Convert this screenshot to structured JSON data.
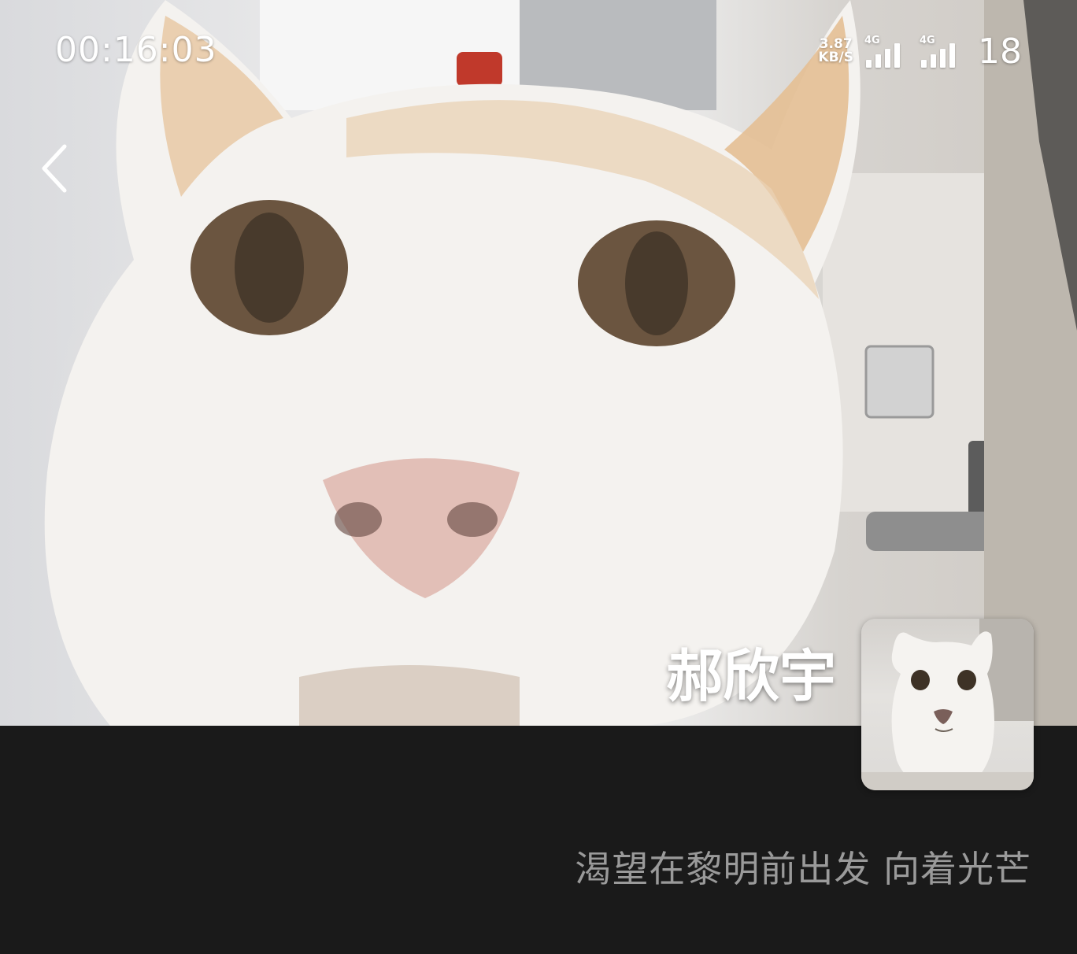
{
  "status_bar": {
    "time": "00:16:03",
    "net_speed_value": "3.87",
    "net_speed_unit": "KB/S",
    "sim1_type": "4G",
    "sim2_type": "4G",
    "battery": "18"
  },
  "call": {
    "caller_name": "郝欣宇",
    "lyric": "渴望在黎明前出发 向着光芒"
  },
  "icons": {
    "back": "chevron-left-icon",
    "signal": "cellular-signal-icon"
  }
}
